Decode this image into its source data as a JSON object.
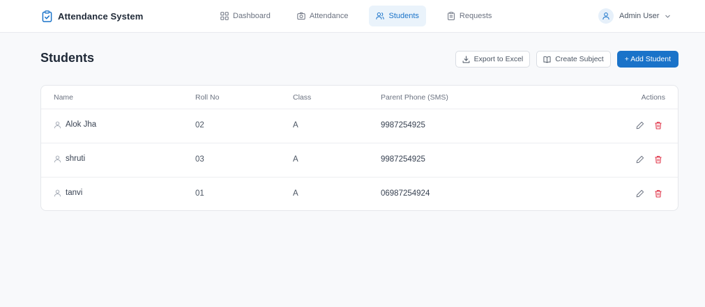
{
  "app": {
    "title": "Attendance System"
  },
  "nav": {
    "items": [
      {
        "label": "Dashboard",
        "icon": "grid-icon",
        "active": false
      },
      {
        "label": "Attendance",
        "icon": "camera-icon",
        "active": false
      },
      {
        "label": "Students",
        "icon": "users-icon",
        "active": true
      },
      {
        "label": "Requests",
        "icon": "clipboard-icon",
        "active": false
      }
    ]
  },
  "user": {
    "name": "Admin User"
  },
  "page": {
    "title": "Students"
  },
  "toolbar": {
    "export_label": "Export to Excel",
    "create_subject_label": "Create Subject",
    "add_student_label": "+ Add Student"
  },
  "table": {
    "columns": [
      "Name",
      "Roll No",
      "Class",
      "Parent Phone (SMS)",
      "Actions"
    ],
    "rows": [
      {
        "name": "Alok Jha",
        "roll": "02",
        "class": "A",
        "phone": "9987254925"
      },
      {
        "name": "shruti",
        "roll": "03",
        "class": "A",
        "phone": "9987254925"
      },
      {
        "name": "tanvi",
        "roll": "01",
        "class": "A",
        "phone": "06987254924"
      }
    ]
  },
  "colors": {
    "accent": "#1a73c9",
    "nav_active_bg": "#eaf3fb",
    "delete": "#e0364a",
    "edit": "#6b7280"
  }
}
